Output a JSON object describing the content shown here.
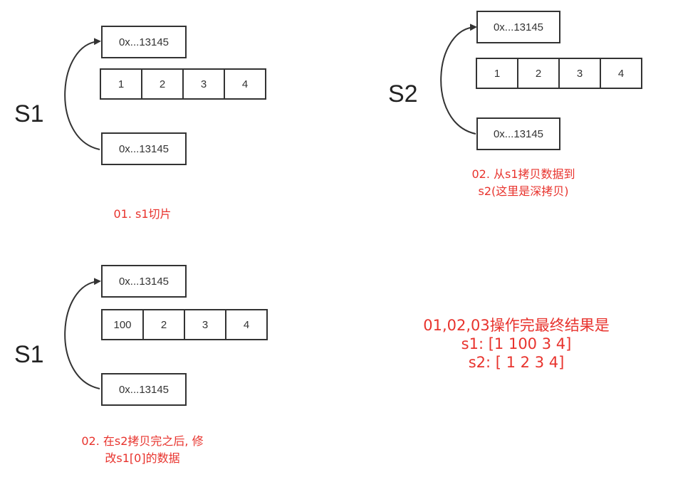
{
  "panel1": {
    "label": "S1",
    "ptr_top": "0x...13145",
    "ptr_bottom": "0x...13145",
    "cells": [
      "1",
      "2",
      "3",
      "4"
    ],
    "note": "01. s1切片"
  },
  "panel2": {
    "label": "S2",
    "ptr_top": "0x...13145",
    "ptr_bottom": "0x...13145",
    "cells": [
      "1",
      "2",
      "3",
      "4"
    ],
    "note_line1": "02. 从s1拷贝数据到",
    "note_line2": "s2(这里是深拷贝)"
  },
  "panel3": {
    "label": "S1",
    "ptr_top": "0x...13145",
    "ptr_bottom": "0x...13145",
    "cells": [
      "100",
      "2",
      "3",
      "4"
    ],
    "note_line1": "02. 在s2拷贝完之后, 修",
    "note_line2": "改s1[0]的数据"
  },
  "result": {
    "line1": "01,02,03操作完最终结果是",
    "line2": "s1: [1 100 3 4]",
    "line3": "s2: [ 1 2 3 4]"
  },
  "colors": {
    "note": "#e8332d",
    "stroke": "#333333"
  }
}
